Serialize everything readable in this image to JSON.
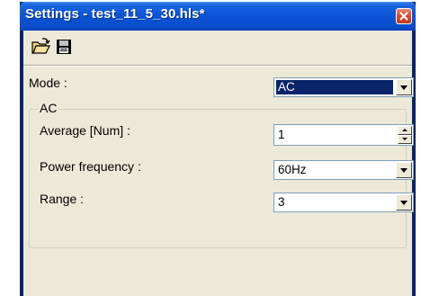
{
  "window": {
    "title": "Settings - test_11_5_30.hls*"
  },
  "toolbar": {
    "open_icon": "folder-open-icon",
    "save_icon": "floppy-save-icon"
  },
  "form": {
    "mode_label": "Mode :",
    "mode_value": "AC",
    "group_title": "AC",
    "average_label": "Average [Num] :",
    "average_value": "1",
    "power_frequency_label": "Power frequency :",
    "power_frequency_value": "60Hz",
    "range_label": "Range :",
    "range_value": "3"
  },
  "colors": {
    "titlebar": "#0a4dcc",
    "selection": "#0a246a",
    "face": "#ece9d8",
    "close_button": "#d6492c"
  }
}
